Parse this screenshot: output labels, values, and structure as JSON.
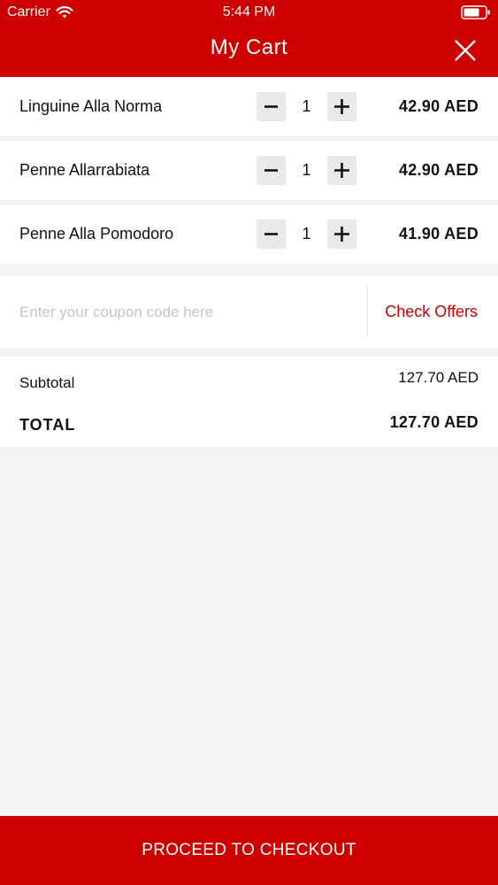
{
  "status_bar": {
    "carrier": "Carrier",
    "time": "5:44 PM",
    "icons": [
      "wifi-icon",
      "battery-icon"
    ]
  },
  "header": {
    "title": "My Cart",
    "close_icon": "close-icon"
  },
  "cart": {
    "items": [
      {
        "name": "Linguine Alla Norma",
        "quantity": "1",
        "price": "42.90 AED"
      },
      {
        "name": "Penne Allarrabiata",
        "quantity": "1",
        "price": "42.90 AED"
      },
      {
        "name": "Penne Alla Pomodoro",
        "quantity": "1",
        "price": "41.90 AED"
      }
    ]
  },
  "coupon": {
    "placeholder": "Enter your coupon code here",
    "value": "",
    "check_offers_label": "Check Offers"
  },
  "totals": {
    "subtotal_label": "Subtotal",
    "subtotal_value": "127.70 AED",
    "total_label": "TOTAL",
    "total_value": "127.70 AED"
  },
  "checkout": {
    "label": "PROCEED TO CHECKOUT"
  },
  "colors": {
    "brand_red": "#cc0000",
    "background": "#f3f3f3"
  }
}
